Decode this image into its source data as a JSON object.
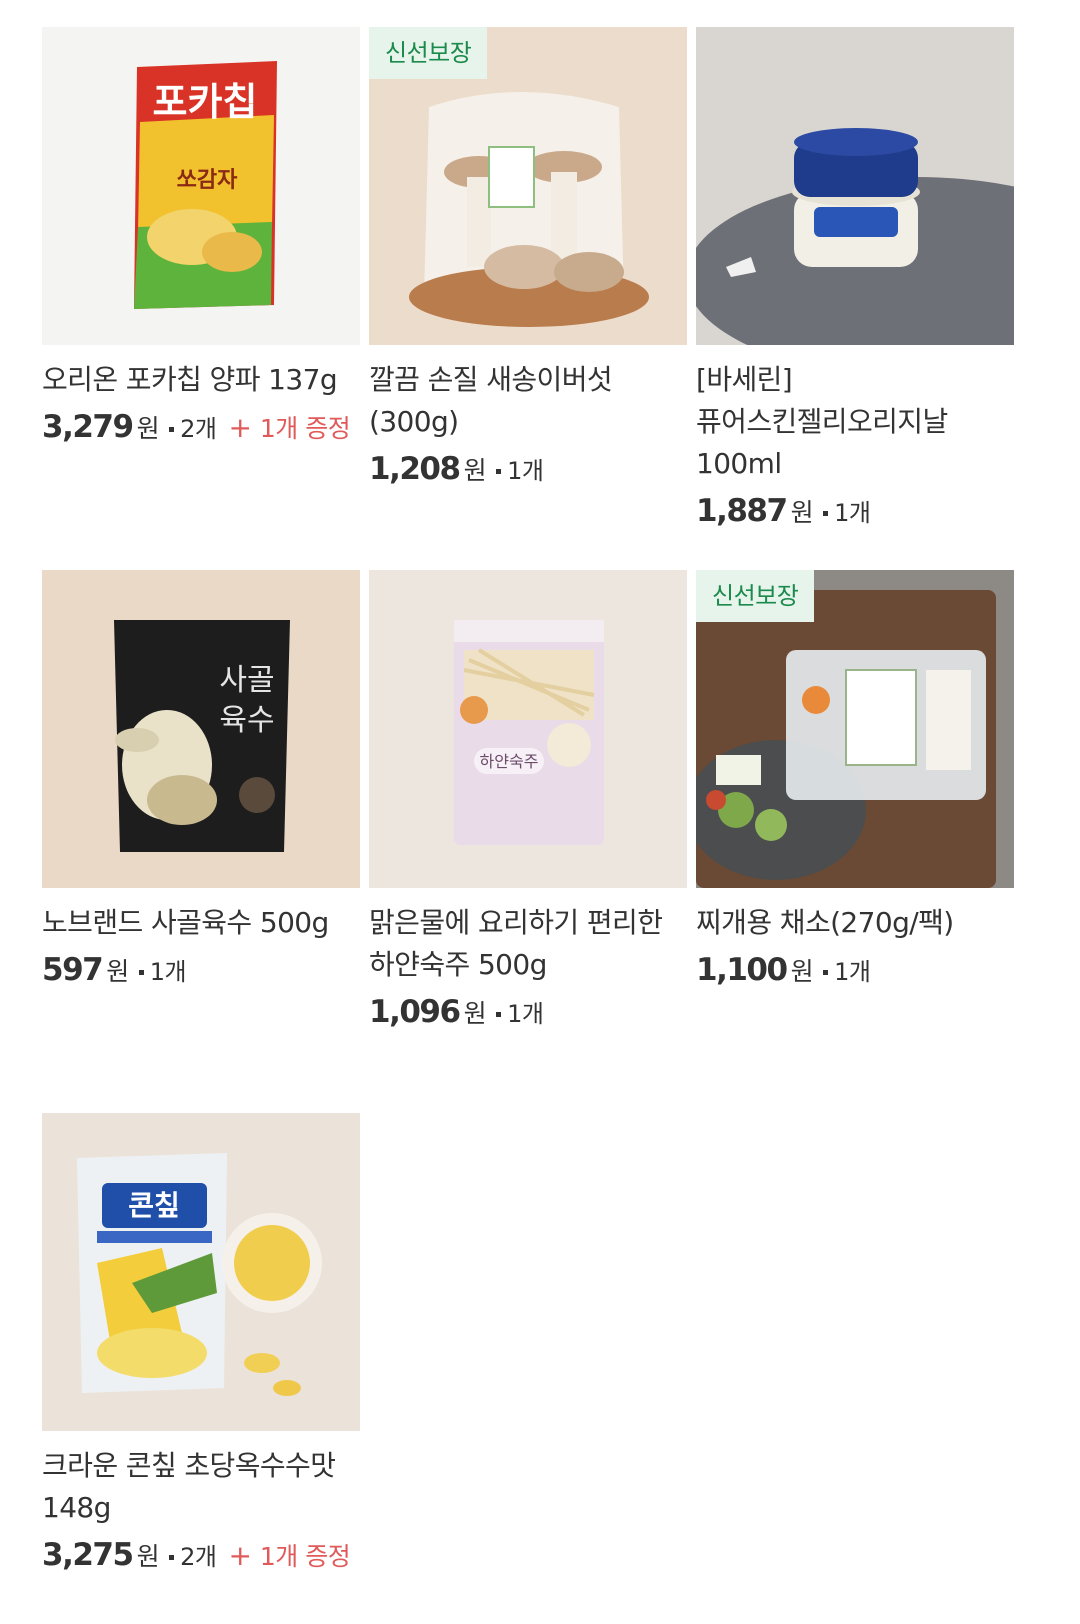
{
  "products": [
    {
      "name": "오리온 포카칩 양파 137g",
      "price": "3,279",
      "currency": "원",
      "quantity": "2개",
      "bonus": "1개 증정",
      "badge": "",
      "image_icon": "chip-bag-photo"
    },
    {
      "name": "깔끔 손질 새송이버섯(300g)",
      "price": "1,208",
      "currency": "원",
      "quantity": "1개",
      "bonus": "",
      "badge": "신선보장",
      "image_icon": "mushroom-photo"
    },
    {
      "name": "[바세린] 퓨어스킨젤리오리지날 100ml",
      "price": "1,887",
      "currency": "원",
      "quantity": "1개",
      "bonus": "",
      "badge": "",
      "image_icon": "jelly-jar-photo"
    },
    {
      "name": "노브랜드 사골육수 500g",
      "price": "597",
      "currency": "원",
      "quantity": "1개",
      "bonus": "",
      "badge": "",
      "image_icon": "broth-pouch-photo"
    },
    {
      "name": "맑은물에 요리하기 편리한 하얀숙주 500g",
      "price": "1,096",
      "currency": "원",
      "quantity": "1개",
      "bonus": "",
      "badge": "",
      "image_icon": "bean-sprout-bag-photo"
    },
    {
      "name": "찌개용 채소(270g/팩)",
      "price": "1,100",
      "currency": "원",
      "quantity": "1개",
      "bonus": "",
      "badge": "신선보장",
      "image_icon": "vegetable-pack-photo"
    },
    {
      "name": "크라운 콘칲 초당옥수수맛 148g",
      "price": "3,275",
      "currency": "원",
      "quantity": "2개",
      "bonus": "1개 증정",
      "badge": "",
      "image_icon": "corn-chip-bag-photo"
    }
  ],
  "colors": {
    "badge_bg": "#e6f4ec",
    "badge_text": "#1b8a4a",
    "bonus_text": "#e05a5a",
    "text": "#333333"
  }
}
